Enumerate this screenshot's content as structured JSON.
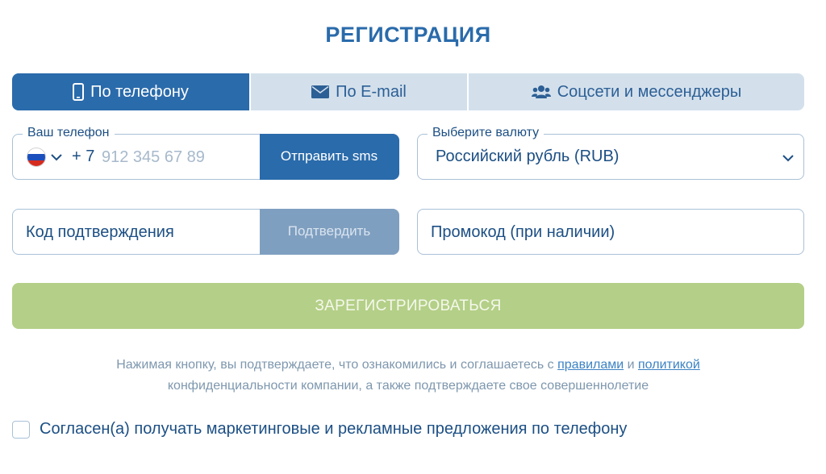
{
  "title": "РЕГИСТРАЦИЯ",
  "tabs": [
    {
      "label": "По телефону",
      "icon": "smartphone-icon",
      "active": true
    },
    {
      "label": "По E-mail",
      "icon": "envelope-icon",
      "active": false
    },
    {
      "label": "Соцсети и мессенджеры",
      "icon": "users-icon",
      "active": false
    }
  ],
  "phone": {
    "legend": "Ваш телефон",
    "country_flag": "ru-flag-icon",
    "prefix": "+ 7",
    "placeholder": "912 345 67 89",
    "send_button": "Отправить sms"
  },
  "currency": {
    "legend": "Выберите валюту",
    "selected": "Российский рубль (RUB)"
  },
  "code": {
    "placeholder": "Код подтверждения",
    "confirm_button": "Подтвердить"
  },
  "promo": {
    "placeholder": "Промокод (при наличии)"
  },
  "register_button": "ЗАРЕГИСТРИРОВАТЬСЯ",
  "terms": {
    "text_before": "Нажимая кнопку, вы подтверждаете, что ознакомились и соглашаетесь с ",
    "rules_link": "правилами",
    "and": " и ",
    "policy_link": "политикой",
    "text_after": "конфиденциальности компании, а также подтверждаете свое совершеннолетие"
  },
  "consent": {
    "label": "Согласен(а) получать маркетинговые и рекламные предложения по телефону",
    "checked": false
  },
  "colors": {
    "primary": "#2a6bab",
    "tab_inactive": "#d3e0ec",
    "register": "#b4cf87",
    "confirm_disabled": "#7f9fc0",
    "link": "#3b82c4"
  }
}
